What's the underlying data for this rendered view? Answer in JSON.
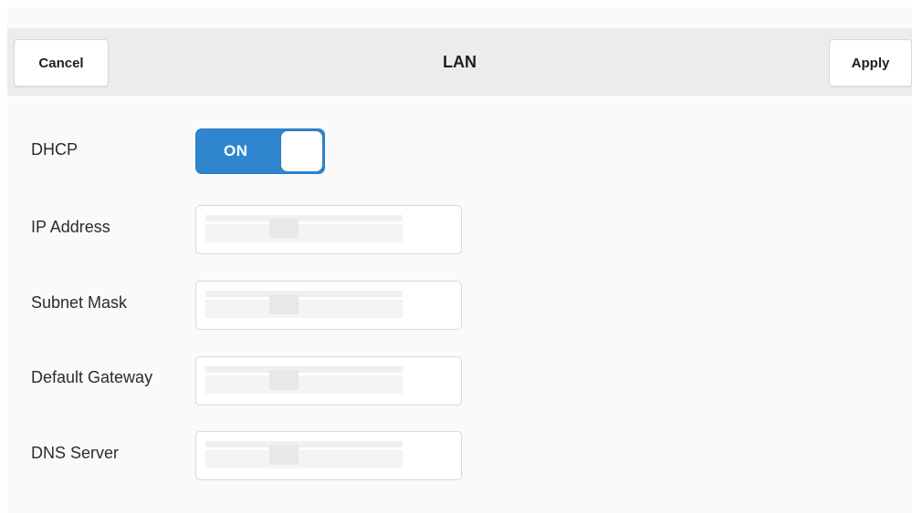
{
  "navbar": {
    "cancel_label": "Cancel",
    "title": "LAN",
    "apply_label": "Apply"
  },
  "dhcp": {
    "label": "DHCP",
    "toggle_state": "ON",
    "enabled": true,
    "accent_color": "#2f86cf"
  },
  "fields": [
    {
      "label": "IP Address",
      "value": ""
    },
    {
      "label": "Subnet Mask",
      "value": ""
    },
    {
      "label": "Default Gateway",
      "value": ""
    },
    {
      "label": "DNS Server",
      "value": ""
    }
  ]
}
